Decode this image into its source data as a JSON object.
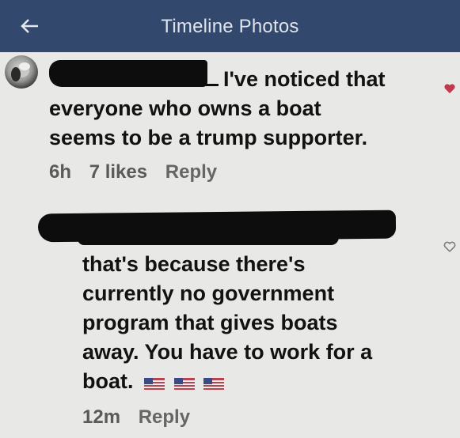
{
  "header": {
    "title": "Timeline Photos",
    "back_icon": "back-arrow-icon",
    "background": "#33486d"
  },
  "comment_1": {
    "name_redacted": true,
    "lines": [
      "I've noticed that",
      "everyone who owns a boat",
      "seems to be a trump supporter."
    ],
    "time": "6h",
    "likes": "7 likes",
    "reply_label": "Reply",
    "heart_icon": "heart-filled-icon",
    "heart_color": "#c0394d"
  },
  "comment_2": {
    "name_redacted": true,
    "lines": [
      "that's because there's",
      "currently no government",
      "program that gives boats",
      "away. You have to work for a",
      "boat."
    ],
    "flag_icon": "us-flag-icon",
    "time": "12m",
    "reply_label": "Reply",
    "heart_icon": "heart-outline-icon"
  }
}
